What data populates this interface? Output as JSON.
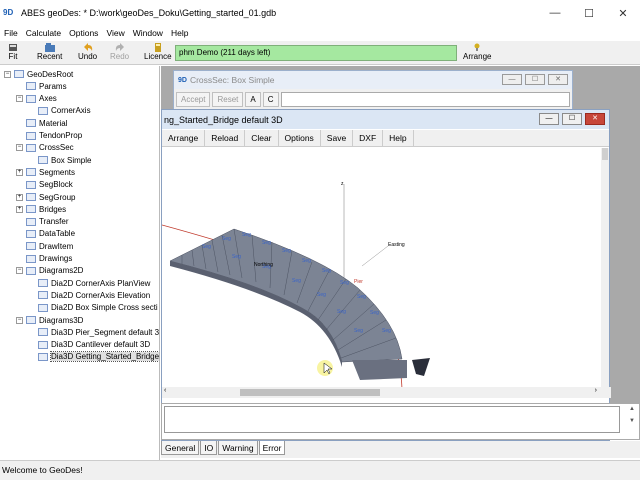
{
  "window": {
    "app_icon": "9D",
    "title": "ABES geoDes:  * D:\\work\\geoDes_Doku\\Getting_started_01.gdb",
    "controls": {
      "minimize": "—",
      "maximize": "☐",
      "close": "✕"
    }
  },
  "menu": [
    "File",
    "Calculate",
    "Options",
    "View",
    "Window",
    "Help"
  ],
  "toolbar": {
    "fit": "Fit",
    "recent": "Recent",
    "undo": "Undo",
    "redo": "Redo",
    "licence": "Licence",
    "licence_message": "phm Demo (211 days left)",
    "arrange": "Arrange"
  },
  "tree": [
    {
      "label": "GeoDesRoot",
      "level": 0,
      "expander": "−"
    },
    {
      "label": "Params",
      "level": 1,
      "expander": ""
    },
    {
      "label": "Axes",
      "level": 1,
      "expander": "−"
    },
    {
      "label": "CornerAxis",
      "level": 2,
      "expander": ""
    },
    {
      "label": "Material",
      "level": 1,
      "expander": ""
    },
    {
      "label": "TendonProp",
      "level": 1,
      "expander": ""
    },
    {
      "label": "CrossSec",
      "level": 1,
      "expander": "−"
    },
    {
      "label": "Box Simple",
      "level": 2,
      "expander": ""
    },
    {
      "label": "Segments",
      "level": 1,
      "expander": "+"
    },
    {
      "label": "SegBlock",
      "level": 1,
      "expander": ""
    },
    {
      "label": "SegGroup",
      "level": 1,
      "expander": "+"
    },
    {
      "label": "Bridges",
      "level": 1,
      "expander": "+"
    },
    {
      "label": "Transfer",
      "level": 1,
      "expander": ""
    },
    {
      "label": "DataTable",
      "level": 1,
      "expander": ""
    },
    {
      "label": "DrawItem",
      "level": 1,
      "expander": ""
    },
    {
      "label": "Drawings",
      "level": 1,
      "expander": ""
    },
    {
      "label": "Diagrams2D",
      "level": 1,
      "expander": "−"
    },
    {
      "label": "Dia2D CornerAxis PlanView",
      "level": 2,
      "expander": ""
    },
    {
      "label": "Dia2D CornerAxis Elevation",
      "level": 2,
      "expander": ""
    },
    {
      "label": "Dia2D Box Simple Cross secti",
      "level": 2,
      "expander": ""
    },
    {
      "label": "Diagrams3D",
      "level": 1,
      "expander": "−"
    },
    {
      "label": "Dia3D Pier_Segment default 3",
      "level": 2,
      "expander": ""
    },
    {
      "label": "Dia3D Cantilever default 3D",
      "level": 2,
      "expander": ""
    },
    {
      "label": "Dia3D Getting_Started_Bridge",
      "level": 2,
      "expander": "",
      "selected": true
    }
  ],
  "crosssec_window": {
    "icon": "9D",
    "title": "CrossSec: Box Simple",
    "buttons": [
      "Accept",
      "Reset",
      "A",
      "C"
    ]
  },
  "view3d_window": {
    "title": "ng_Started_Bridge default 3D",
    "tools": [
      "Arrange",
      "Reload",
      "Clear",
      "Options",
      "Save",
      "DXF",
      "Help"
    ],
    "labels": {
      "z": "z",
      "easting": "Easting",
      "northing": "Northing",
      "pier": "Pier"
    }
  },
  "tabs": [
    "General",
    "IO",
    "Warning",
    "Error"
  ],
  "status": "Welcome to GeoDes!",
  "colors": {
    "deck": "#7c8494",
    "axis": "#c0392b",
    "licence": "#a5e8a0",
    "selection": "#e0e0e0"
  }
}
